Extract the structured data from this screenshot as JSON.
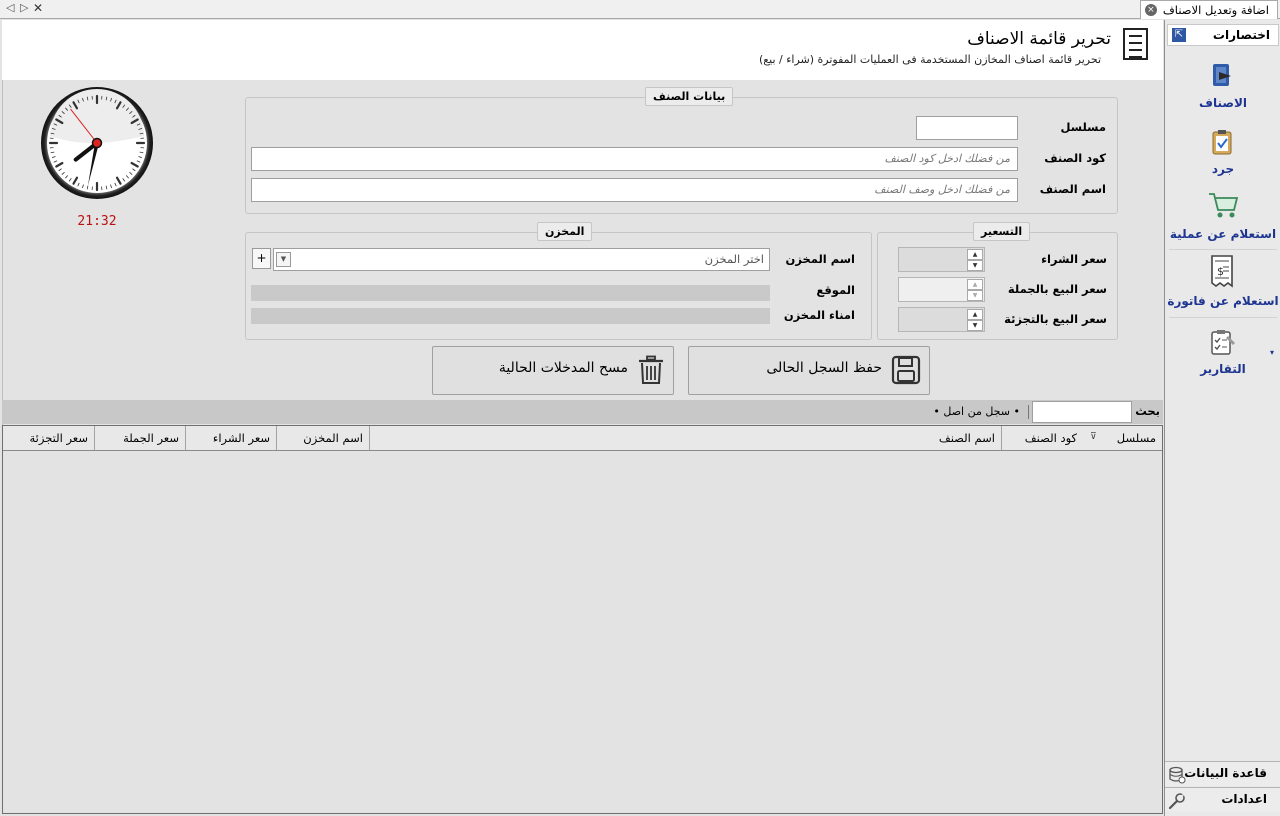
{
  "tab": {
    "title": "اضافة وتعديل الاصناف",
    "nav_prev": "◁",
    "nav_next": "▷",
    "close": "✕",
    "tab_close": "×"
  },
  "header": {
    "title": "تحرير قائمة الاصناف",
    "subtitle": "تحرير قائمة اصناف المخازن المستخدمة فى العمليات المفوترة (شراء / بيع)",
    "icon": "list-document-icon"
  },
  "clock": {
    "time": "21:32",
    "hour_hand_deg": -128,
    "minute_hand_deg": 192,
    "second_hand_deg": -38
  },
  "item_group": {
    "legend": "بيانات الصنف",
    "serial_label": "مسلسل",
    "serial_value": "",
    "code_label": "كود الصنف",
    "code_placeholder": "من فضلك ادخل كود الصنف",
    "name_label": "اسم الصنف",
    "name_placeholder": "من فضلك ادخل وصف الصنف"
  },
  "pricing_group": {
    "legend": "التسعير",
    "purchase_label": "سعر الشراء",
    "wholesale_label": "سعر البيع بالجملة",
    "retail_label": "سعر البيع بالتجزئة"
  },
  "store_group": {
    "legend": "المخزن",
    "store_label": "اسم المخزن",
    "store_placeholder": "اختر المخزن",
    "add_symbol": "+",
    "location_label": "الموقع",
    "keeper_label": "امناء المخزن"
  },
  "actions": {
    "save_label": "حفظ السجل الحالى",
    "clear_label": "مسح المدخلات الحالية"
  },
  "search": {
    "label": "بحث",
    "value": "",
    "record_count": "• سجل من اصل •"
  },
  "grid": {
    "columns": [
      "مسلسل",
      "كود الصنف",
      "اسم الصنف",
      "اسم المخزن",
      "سعر الشراء",
      "سعر الجملة",
      "سعر التجزئة"
    ],
    "filter_symbol": "⊽",
    "rows": []
  },
  "sidebar": {
    "title": "اختصارات",
    "pin_symbol": "⇱",
    "items": [
      {
        "label": "الاصناف",
        "icon": "items-book-icon"
      },
      {
        "label": "جرد",
        "icon": "clipboard-check-icon"
      },
      {
        "label": "استعلام عن عملية",
        "icon": "shopping-cart-icon"
      },
      {
        "label": "استعلام عن فاتورة",
        "icon": "invoice-receipt-icon"
      },
      {
        "label": "التقارير",
        "icon": "reports-clipboard-icon"
      }
    ],
    "more_symbol": "▾",
    "footer": [
      {
        "label": "قاعدة البيانات",
        "icon": "database-icon"
      },
      {
        "label": "اعدادات",
        "icon": "wrench-icon"
      }
    ]
  },
  "colors": {
    "accent": "#1d3591",
    "clock_time": "#bb1111",
    "face_bg": "#ffffff",
    "grid_bg": "#e3e3e3"
  }
}
